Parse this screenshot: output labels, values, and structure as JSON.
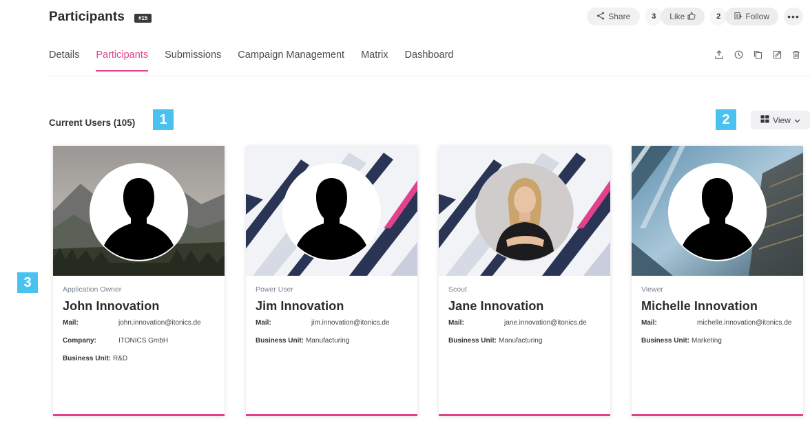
{
  "header": {
    "title": "Participants",
    "id_badge": "#15",
    "share_label": "Share",
    "like_count": "3",
    "like_label": "Like",
    "follow_count": "2",
    "follow_label": "Follow",
    "more_label": "•••"
  },
  "tabs": [
    {
      "label": "Details"
    },
    {
      "label": "Participants",
      "active": true
    },
    {
      "label": "Submissions"
    },
    {
      "label": "Campaign Management"
    },
    {
      "label": "Matrix"
    },
    {
      "label": "Dashboard"
    }
  ],
  "toolbar_icons": [
    "export-icon",
    "history-icon",
    "copy-icon",
    "edit-icon",
    "delete-icon"
  ],
  "section": {
    "title": "Current Users (105)",
    "view_label": "View"
  },
  "markers": [
    "1",
    "2",
    "3"
  ],
  "users": [
    {
      "role": "Application Owner",
      "name": "John Innovation",
      "fields": [
        {
          "key": "Mail:",
          "value": "john.innovation@itonics.de"
        },
        {
          "key": "Company:",
          "value": "ITONICS GmbH"
        },
        {
          "key": "Business Unit:",
          "value": "R&D"
        }
      ]
    },
    {
      "role": "Power User",
      "name": "Jim Innovation",
      "fields": [
        {
          "key": "Mail:",
          "value": "jim.innovation@itonics.de"
        },
        {
          "key": "Business Unit:",
          "value": "Manufacturing"
        }
      ]
    },
    {
      "role": "Scout",
      "name": "Jane Innovation",
      "fields": [
        {
          "key": "Mail:",
          "value": "jane.innovation@itonics.de"
        },
        {
          "key": "Business Unit:",
          "value": "Manufacturing"
        }
      ]
    },
    {
      "role": "Viewer",
      "name": "Michelle Innovation",
      "fields": [
        {
          "key": "Mail:",
          "value": "michelle.innovation@itonics.de"
        },
        {
          "key": "Business Unit:",
          "value": "Marketing"
        }
      ]
    }
  ],
  "colors": {
    "accent": "#e2418c",
    "marker": "#49c2f0"
  }
}
